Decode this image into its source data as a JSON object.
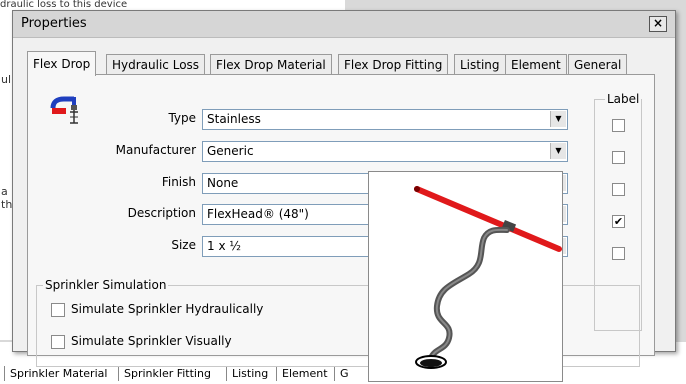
{
  "background": {
    "top_fragment": "draulic loss to this device",
    "left_fragments": [
      "ul",
      "a",
      "th"
    ],
    "bottom_tabs": [
      "Sprinkler Material",
      "Sprinkler Fitting",
      "Listing",
      "Element",
      "G"
    ]
  },
  "dialog": {
    "title": "Properties",
    "close_label": "×",
    "tabs": [
      {
        "label": "Flex Drop",
        "active": true
      },
      {
        "label": "Hydraulic Loss"
      },
      {
        "label": "Flex Drop Material"
      },
      {
        "label": "Flex Drop Fitting"
      },
      {
        "label": "Listing"
      },
      {
        "label": "Element"
      },
      {
        "label": "General"
      }
    ],
    "label_column_title": "Label",
    "fields": [
      {
        "label": "Type",
        "value": "Stainless",
        "label_checked": false
      },
      {
        "label": "Manufacturer",
        "value": "Generic",
        "label_checked": false
      },
      {
        "label": "Finish",
        "value": "None",
        "label_checked": false
      },
      {
        "label": "Description",
        "value": "FlexHead® (48\")",
        "label_checked": true
      },
      {
        "label": "Size",
        "value": "1 x ½",
        "label_checked": false
      }
    ],
    "sprinkler_simulation": {
      "title": "Sprinkler Simulation",
      "options": [
        {
          "label": "Simulate Sprinkler Hydraulically",
          "checked": false
        },
        {
          "label": "Simulate Sprinkler Visually",
          "checked": false
        }
      ]
    }
  },
  "colors": {
    "pipe_red": "#e0191b",
    "hose_gray": "#555555"
  }
}
